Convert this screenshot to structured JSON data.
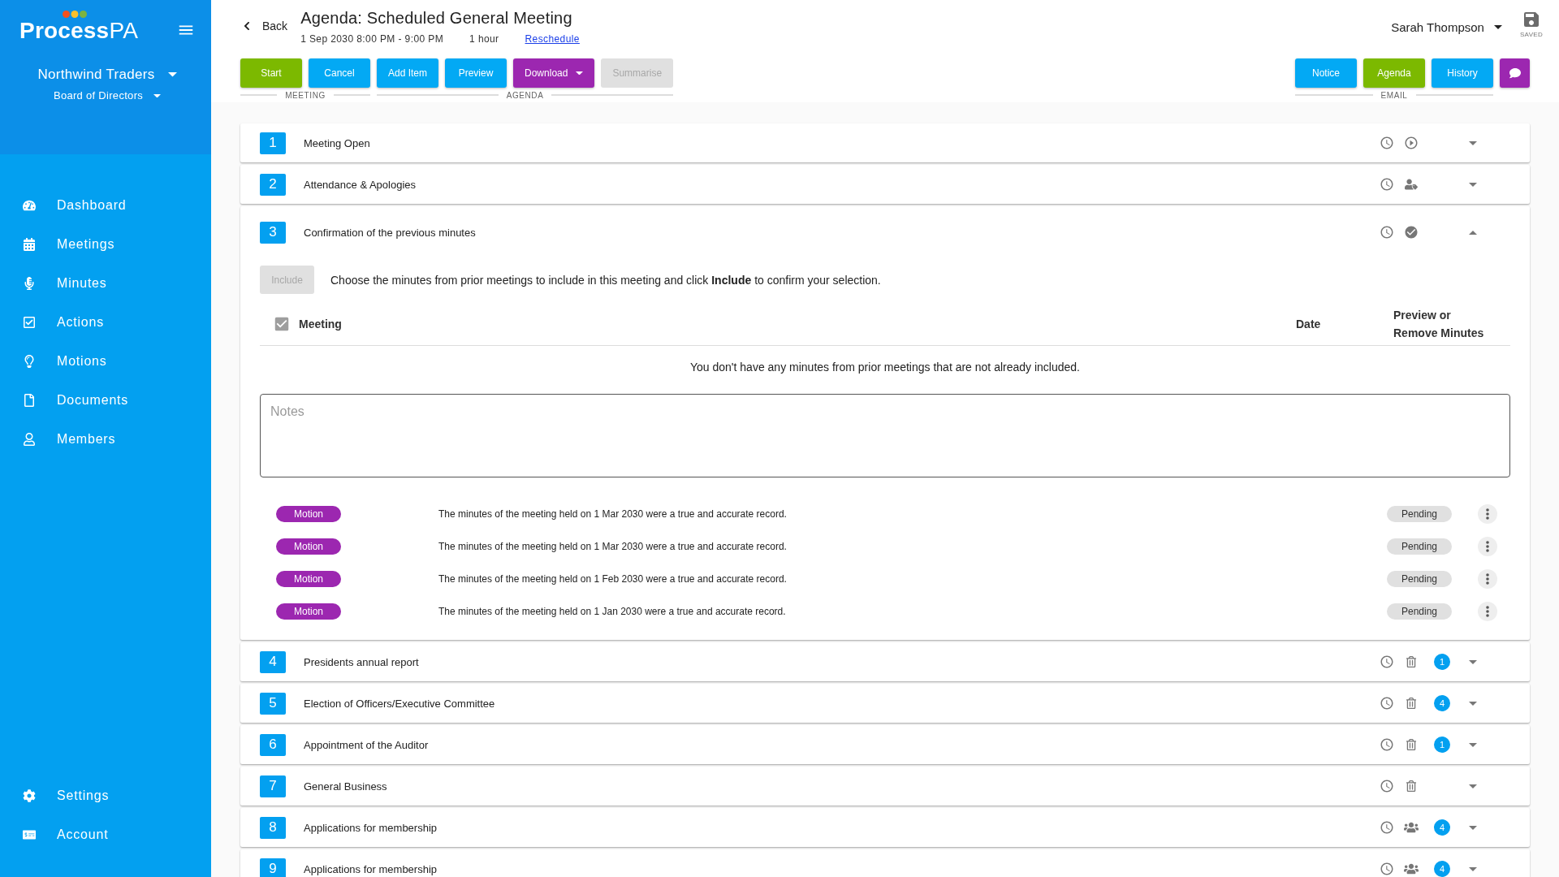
{
  "sidebar": {
    "logo": "**Process**PA",
    "organization": "Northwind Traders",
    "committee": "Board of Directors",
    "nav_items": [
      {
        "label": "Dashboard"
      },
      {
        "label": "Meetings"
      },
      {
        "label": "Minutes"
      },
      {
        "label": "Actions"
      },
      {
        "label": "Motions"
      },
      {
        "label": "Documents"
      },
      {
        "label": "Members"
      }
    ],
    "footer_items": [
      {
        "label": "Settings"
      },
      {
        "label": "Account"
      }
    ]
  },
  "header": {
    "back": "Back",
    "title": "Agenda: Scheduled General Meeting",
    "datetime": "1 Sep 2030 8:00 PM - 9:00 PM",
    "duration": "1 hour",
    "reschedule": "Reschedule",
    "user": "Sarah Thompson",
    "save_status": "SAVED"
  },
  "toolbar": {
    "left_groups": [
      {
        "label": "MEETING",
        "buttons": [
          {
            "label": "Start",
            "kind": "plain",
            "color": "#7cb900",
            "disabled": false
          },
          {
            "label": "Cancel",
            "kind": "plain",
            "color": "#03a9f4",
            "disabled": false
          }
        ]
      },
      {
        "label": "AGENDA",
        "buttons": [
          {
            "label": "Add Item",
            "kind": "plain",
            "color": "#03a9f4",
            "disabled": false
          },
          {
            "label": "Preview",
            "kind": "plain",
            "color": "#03a9f4",
            "disabled": false
          },
          {
            "label": "Download",
            "kind": "dropdown",
            "color": "#9c27b0",
            "disabled": false
          },
          {
            "label": "Summarise",
            "kind": "plain",
            "color": "#e0e0e0",
            "disabled": true
          }
        ]
      }
    ],
    "right_groups": [
      {
        "label": "EMAIL",
        "buttons": [
          {
            "label": "Notice",
            "kind": "plain",
            "color": "#03a9f4",
            "disabled": false
          },
          {
            "label": "Agenda",
            "kind": "plain",
            "color": "#7cb900",
            "disabled": false
          },
          {
            "label": "History",
            "kind": "plain",
            "color": "#03a9f4",
            "disabled": false
          }
        ]
      }
    ]
  },
  "agenda_items": [
    {
      "number": "1",
      "title": "Meeting Open",
      "kind": "start",
      "expanded": false
    },
    {
      "number": "2",
      "title": "Attendance & Apologies",
      "kind": "attendance",
      "expanded": false
    },
    {
      "number": "3",
      "title": "Confirmation of the previous minutes",
      "kind": "minutes",
      "expanded": true,
      "minutes_panel": {
        "include_button": {
          "label": "Include",
          "disabled": true
        },
        "instructions": "Choose the minutes from prior meetings to include in this meeting and click **Include** to confirm your selection.",
        "select_all": {
          "checked": true,
          "disabled": true
        },
        "columns": [
          "Meeting",
          "Date",
          "Preview or Remove Minutes"
        ],
        "empty_message": "You don't have any minutes from prior meetings that are not already included.",
        "notes": {
          "placeholder": "Notes"
        },
        "motions": [
          {
            "tag": "Motion",
            "text": "The minutes of the meeting held on 1 Mar 2030 were a true and accurate record.",
            "status": "Pending"
          },
          {
            "tag": "Motion",
            "text": "The minutes of the meeting held on 1 Mar 2030 were a true and accurate record.",
            "status": "Pending"
          },
          {
            "tag": "Motion",
            "text": "The minutes of the meeting held on 1 Feb 2030 were a true and accurate record.",
            "status": "Pending"
          },
          {
            "tag": "Motion",
            "text": "The minutes of the meeting held on 1 Jan 2030 were a true and accurate record.",
            "status": "Pending"
          }
        ]
      }
    },
    {
      "number": "4",
      "title": "Presidents annual report",
      "kind": "general",
      "expanded": false,
      "count": "1"
    },
    {
      "number": "5",
      "title": "Election of Officers/Executive Committee",
      "kind": "general",
      "expanded": false,
      "count": "4"
    },
    {
      "number": "6",
      "title": "Appointment of the Auditor",
      "kind": "general",
      "expanded": false,
      "count": "1"
    },
    {
      "number": "7",
      "title": "General Business",
      "kind": "general",
      "expanded": false
    },
    {
      "number": "8",
      "title": "Applications for membership",
      "kind": "membership",
      "expanded": false,
      "count": "4"
    },
    {
      "number": "9",
      "title": "Applications for membership",
      "kind": "membership",
      "expanded": false,
      "count": "4"
    }
  ]
}
